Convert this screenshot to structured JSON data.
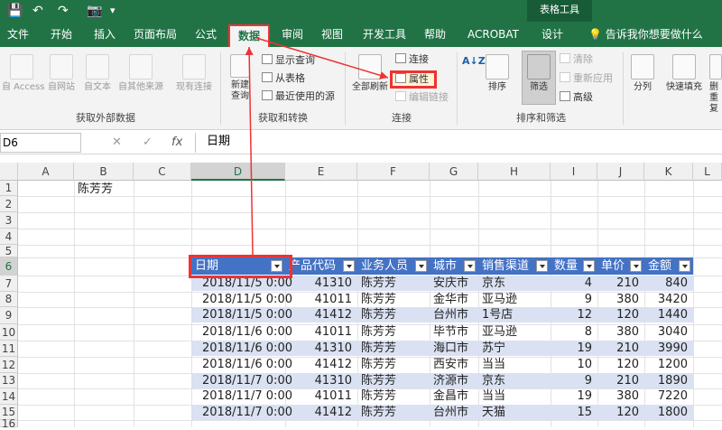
{
  "titlebar": {
    "qa_save": "💾",
    "qa_undo": "↶",
    "qa_redo": "↷",
    "qa_camera": "📷",
    "qa_more": "▾",
    "tool_title": "表格工具"
  },
  "tabs": [
    "文件",
    "开始",
    "插入",
    "页面布局",
    "公式",
    "数据",
    "审阅",
    "视图",
    "开发工具",
    "帮助",
    "ACROBAT",
    "设计"
  ],
  "tell_me": "告诉我你想要做什么",
  "ribbon": {
    "external": {
      "access": "自 Access",
      "web": "自网站",
      "text": "自文本",
      "other": "自其他来源",
      "existing": "现有连接",
      "group": "获取外部数据"
    },
    "transform": {
      "newquery": "新建\n查询",
      "show": "显示查询",
      "fromtable": "从表格",
      "recent": "最近使用的源",
      "group": "获取和转换"
    },
    "connections": {
      "refresh": "全部刷新",
      "conn": "连接",
      "props": "属性",
      "editlinks": "编辑链接",
      "group": "连接"
    },
    "sortfilter": {
      "az": "A↓Z",
      "sort": "排序",
      "filter": "筛选",
      "clear": "清除",
      "reapply": "重新应用",
      "advanced": "高级",
      "group": "排序和筛选"
    },
    "tools": {
      "split": "分列",
      "flash": "快速填充",
      "remove": "删\n重复"
    }
  },
  "formula": {
    "namebox": "D6",
    "cancel": "✕",
    "ok": "✓",
    "fx": "fx",
    "value": "日期"
  },
  "columns": [
    "A",
    "B",
    "C",
    "D",
    "E",
    "F",
    "G",
    "H",
    "I",
    "J",
    "K",
    "L"
  ],
  "rows": [
    "1",
    "2",
    "3",
    "4",
    "5",
    "6",
    "7",
    "8",
    "9",
    "10",
    "11",
    "12",
    "13",
    "14",
    "15",
    "16"
  ],
  "b1": "陈芳芳",
  "table": {
    "headers": [
      "日期",
      "产品代码",
      "业务人员",
      "城市",
      "销售渠道",
      "数量",
      "单价",
      "金额"
    ],
    "rows": [
      [
        "2018/11/5 0:00",
        "41310",
        "陈芳芳",
        "安庆市",
        "京东",
        "4",
        "210",
        "840"
      ],
      [
        "2018/11/5 0:00",
        "41011",
        "陈芳芳",
        "金华市",
        "亚马逊",
        "9",
        "380",
        "3420"
      ],
      [
        "2018/11/5 0:00",
        "41412",
        "陈芳芳",
        "台州市",
        "1号店",
        "12",
        "120",
        "1440"
      ],
      [
        "2018/11/6 0:00",
        "41011",
        "陈芳芳",
        "毕节市",
        "亚马逊",
        "8",
        "380",
        "3040"
      ],
      [
        "2018/11/6 0:00",
        "41310",
        "陈芳芳",
        "海口市",
        "苏宁",
        "19",
        "210",
        "3990"
      ],
      [
        "2018/11/6 0:00",
        "41412",
        "陈芳芳",
        "西安市",
        "当当",
        "10",
        "120",
        "1200"
      ],
      [
        "2018/11/7 0:00",
        "41310",
        "陈芳芳",
        "济源市",
        "京东",
        "9",
        "210",
        "1890"
      ],
      [
        "2018/11/7 0:00",
        "41011",
        "陈芳芳",
        "金昌市",
        "当当",
        "19",
        "380",
        "7220"
      ],
      [
        "2018/11/7 0:00",
        "41412",
        "陈芳芳",
        "台州市",
        "天猫",
        "15",
        "120",
        "1800"
      ]
    ]
  }
}
